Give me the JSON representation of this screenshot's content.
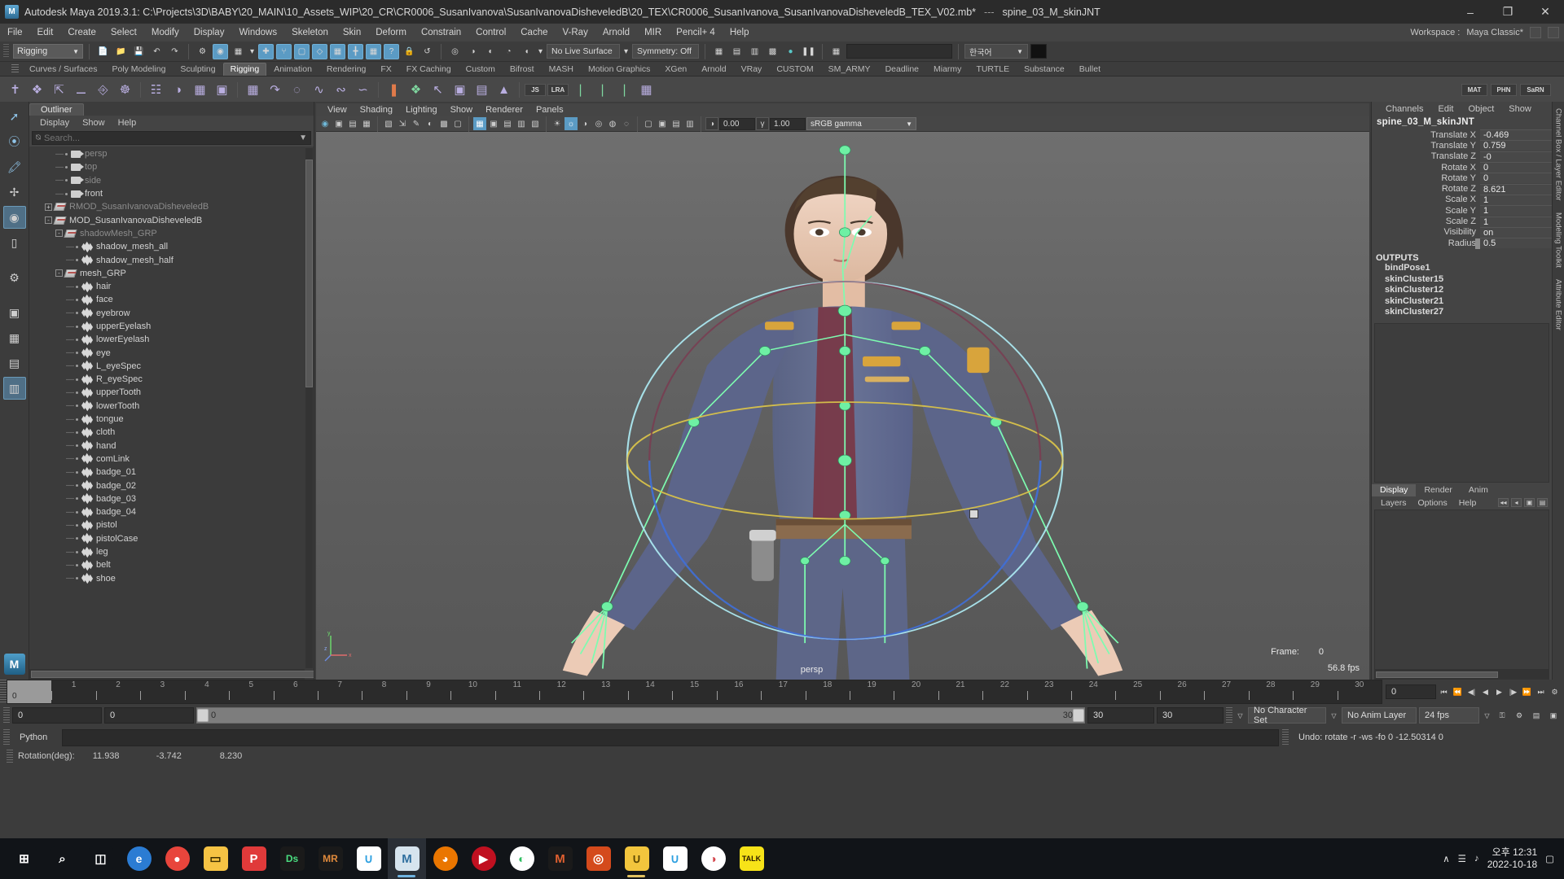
{
  "titlebar": {
    "app_title": "Autodesk Maya 2019.3.1: C:\\Projects\\3D\\BABY\\20_MAIN\\10_Assets_WIP\\20_CR\\CR0006_SusanIvanova\\SusanIvanovaDisheveledB\\20_TEX\\CR0006_SusanIvanova_SusanIvanovaDisheveledB_TEX_V02.mb*",
    "separator": "---",
    "selection": "spine_03_M_skinJNT",
    "logo": "M",
    "minimize": "–",
    "maximize": "❐",
    "close": "✕"
  },
  "menubar": {
    "items": [
      "File",
      "Edit",
      "Create",
      "Select",
      "Modify",
      "Display",
      "Windows",
      "Skeleton",
      "Skin",
      "Deform",
      "Constrain",
      "Control",
      "Cache",
      "V-Ray",
      "Arnold",
      "MIR",
      "Pencil+ 4",
      "Help"
    ],
    "workspace_label": "Workspace :",
    "workspace_value": "Maya Classic*"
  },
  "statusline": {
    "menuset": "Rigging",
    "live_surface": "No Live Surface",
    "symmetry": "Symmetry: Off",
    "quick_select": "한국어",
    "icons": [
      "new-scene-icon",
      "open-scene-icon",
      "save-scene-icon",
      "undo-icon",
      "redo-icon",
      "select-hierarchy-icon",
      "select-object-icon",
      "select-component-icon",
      "snap-grid-icon",
      "snap-curve-icon",
      "snap-point-icon",
      "snap-view-plane-icon",
      "snap-projected-center-icon",
      "construction-history-icon",
      "render-icon",
      "lock-icon",
      "input-output-icon",
      "render-view-icon",
      "ipr-icon",
      "render-settings-icon",
      "hypershade-icon",
      "light-editor-icon"
    ]
  },
  "shelf": {
    "tabs": [
      "Curves / Surfaces",
      "Poly Modeling",
      "Sculpting",
      "Rigging",
      "Animation",
      "Rendering",
      "FX",
      "FX Caching",
      "Custom",
      "Bifrost",
      "MASH",
      "Motion Graphics",
      "XGen",
      "Arnold",
      "VRay",
      "CUSTOM",
      "SM_ARMY",
      "Deadline",
      "Miarmy",
      "TURTLE",
      "Substance",
      "Bullet"
    ],
    "active_tab": "Rigging",
    "button_labels": [
      "JS",
      "LRA",
      "MAT",
      "PHN",
      "SaRN"
    ]
  },
  "outliner": {
    "tab": "Outliner",
    "menu": [
      "Display",
      "Show",
      "Help"
    ],
    "search_placeholder": "Search...",
    "items": [
      {
        "label": "persp",
        "indent": 2,
        "icon": "camera-icon",
        "dim": true,
        "expander": ""
      },
      {
        "label": "top",
        "indent": 2,
        "icon": "camera-icon",
        "dim": true,
        "expander": ""
      },
      {
        "label": "side",
        "indent": 2,
        "icon": "camera-icon",
        "dim": true,
        "expander": ""
      },
      {
        "label": "front",
        "indent": 2,
        "icon": "camera-icon",
        "dim": false,
        "expander": ""
      },
      {
        "label": "RMOD_SusanIvanovaDisheveledB",
        "indent": 1,
        "icon": "group-icon",
        "dim": true,
        "expander": "+"
      },
      {
        "label": "MOD_SusanIvanovaDisheveledB",
        "indent": 1,
        "icon": "group-icon",
        "dim": false,
        "expander": "-"
      },
      {
        "label": "shadowMesh_GRP",
        "indent": 2,
        "icon": "group-icon",
        "dim": true,
        "expander": "-"
      },
      {
        "label": "shadow_mesh_all",
        "indent": 3,
        "icon": "mesh-icon",
        "dim": false,
        "expander": ""
      },
      {
        "label": "shadow_mesh_half",
        "indent": 3,
        "icon": "mesh-icon",
        "dim": false,
        "expander": ""
      },
      {
        "label": "mesh_GRP",
        "indent": 2,
        "icon": "group-icon",
        "dim": false,
        "expander": "-"
      },
      {
        "label": "hair",
        "indent": 3,
        "icon": "mesh-icon",
        "dim": false,
        "expander": ""
      },
      {
        "label": "face",
        "indent": 3,
        "icon": "mesh-icon",
        "dim": false,
        "expander": ""
      },
      {
        "label": "eyebrow",
        "indent": 3,
        "icon": "mesh-icon",
        "dim": false,
        "expander": ""
      },
      {
        "label": "upperEyelash",
        "indent": 3,
        "icon": "mesh-icon",
        "dim": false,
        "expander": ""
      },
      {
        "label": "lowerEyelash",
        "indent": 3,
        "icon": "mesh-icon",
        "dim": false,
        "expander": ""
      },
      {
        "label": "eye",
        "indent": 3,
        "icon": "mesh-icon",
        "dim": false,
        "expander": ""
      },
      {
        "label": "L_eyeSpec",
        "indent": 3,
        "icon": "mesh-icon",
        "dim": false,
        "expander": ""
      },
      {
        "label": "R_eyeSpec",
        "indent": 3,
        "icon": "mesh-icon",
        "dim": false,
        "expander": ""
      },
      {
        "label": "upperTooth",
        "indent": 3,
        "icon": "mesh-icon",
        "dim": false,
        "expander": ""
      },
      {
        "label": "lowerTooth",
        "indent": 3,
        "icon": "mesh-icon",
        "dim": false,
        "expander": ""
      },
      {
        "label": "tongue",
        "indent": 3,
        "icon": "mesh-icon",
        "dim": false,
        "expander": ""
      },
      {
        "label": "cloth",
        "indent": 3,
        "icon": "mesh-icon",
        "dim": false,
        "expander": ""
      },
      {
        "label": "hand",
        "indent": 3,
        "icon": "mesh-icon",
        "dim": false,
        "expander": ""
      },
      {
        "label": "comLink",
        "indent": 3,
        "icon": "mesh-icon",
        "dim": false,
        "expander": ""
      },
      {
        "label": "badge_01",
        "indent": 3,
        "icon": "mesh-icon",
        "dim": false,
        "expander": ""
      },
      {
        "label": "badge_02",
        "indent": 3,
        "icon": "mesh-icon",
        "dim": false,
        "expander": ""
      },
      {
        "label": "badge_03",
        "indent": 3,
        "icon": "mesh-icon",
        "dim": false,
        "expander": ""
      },
      {
        "label": "badge_04",
        "indent": 3,
        "icon": "mesh-icon",
        "dim": false,
        "expander": ""
      },
      {
        "label": "pistol",
        "indent": 3,
        "icon": "mesh-icon",
        "dim": false,
        "expander": ""
      },
      {
        "label": "pistolCase",
        "indent": 3,
        "icon": "mesh-icon",
        "dim": false,
        "expander": ""
      },
      {
        "label": "leg",
        "indent": 3,
        "icon": "mesh-icon",
        "dim": false,
        "expander": ""
      },
      {
        "label": "belt",
        "indent": 3,
        "icon": "mesh-icon",
        "dim": false,
        "expander": ""
      },
      {
        "label": "shoe",
        "indent": 3,
        "icon": "mesh-icon",
        "dim": false,
        "expander": ""
      }
    ]
  },
  "viewport": {
    "menu": [
      "View",
      "Shading",
      "Lighting",
      "Show",
      "Renderer",
      "Panels"
    ],
    "exposure": "0.00",
    "gamma": "1.00",
    "colorspace": "sRGB gamma",
    "camera_label": "persp",
    "frame_label": "Frame:",
    "frame_value": "0",
    "fps": "56.8 fps",
    "axis_labels": {
      "x": "x",
      "y": "y",
      "z": "z"
    }
  },
  "channelbox": {
    "menu": [
      "Channels",
      "Edit",
      "Object",
      "Show"
    ],
    "node_name": "spine_03_M_skinJNT",
    "attributes": [
      {
        "label": "Translate X",
        "value": "-0.469"
      },
      {
        "label": "Translate Y",
        "value": "0.759"
      },
      {
        "label": "Translate Z",
        "value": "-0"
      },
      {
        "label": "Rotate X",
        "value": "0"
      },
      {
        "label": "Rotate Y",
        "value": "0"
      },
      {
        "label": "Rotate Z",
        "value": "8.621"
      },
      {
        "label": "Scale X",
        "value": "1"
      },
      {
        "label": "Scale Y",
        "value": "1"
      },
      {
        "label": "Scale Z",
        "value": "1"
      },
      {
        "label": "Visibility",
        "value": "on"
      },
      {
        "label": "Radius",
        "value": "0.5"
      }
    ],
    "outputs_header": "OUTPUTS",
    "outputs": [
      "bindPose1",
      "skinCluster15",
      "skinCluster12",
      "skinCluster21",
      "skinCluster27"
    ]
  },
  "layer_editor": {
    "tabs": [
      "Display",
      "Render",
      "Anim"
    ],
    "active_tab": "Display",
    "menu": [
      "Layers",
      "Options",
      "Help"
    ]
  },
  "edge_tabs": [
    "Channel Box / Layer Editor",
    "Modeling Toolkit",
    "Attribute Editor"
  ],
  "timeline": {
    "ticks": [
      "0",
      "1",
      "2",
      "3",
      "4",
      "5",
      "6",
      "7",
      "8",
      "9",
      "10",
      "11",
      "12",
      "13",
      "14",
      "15",
      "16",
      "17",
      "18",
      "19",
      "20",
      "21",
      "22",
      "23",
      "24",
      "25",
      "26",
      "27",
      "28",
      "29",
      "30"
    ],
    "current_frame": "0",
    "range_start": "0",
    "range_end": "0",
    "playback_start": "0",
    "playback_end": "30",
    "anim_start": "30",
    "anim_end": "30",
    "character_set": "No Character Set",
    "anim_layer": "No Anim Layer",
    "fps_setting": "24 fps",
    "playback_buttons": [
      "go-to-start-icon",
      "step-back-key-icon",
      "step-back-frame-icon",
      "play-backwards-icon",
      "play-forwards-icon",
      "step-forward-frame-icon",
      "step-forward-key-icon",
      "go-to-end-icon"
    ]
  },
  "commandline": {
    "language": "Python",
    "input_value": "",
    "message": "Undo: rotate -r -ws -fo 0 -12.50314 0"
  },
  "helpline": {
    "label": "Rotation(deg):",
    "values": [
      "11.938",
      "-3.742",
      "8.230"
    ]
  },
  "taskbar": {
    "items": [
      {
        "name": "start-button",
        "glyph": "⊞",
        "bg": "#111418",
        "color": "#ffffff"
      },
      {
        "name": "search-button",
        "glyph": "⌕",
        "bg": "#111418",
        "color": "#ffffff"
      },
      {
        "name": "task-view-button",
        "glyph": "◫",
        "bg": "#111418",
        "color": "#ffffff"
      },
      {
        "name": "edge-icon",
        "glyph": "e",
        "bg": "#2b7cd3",
        "color": "#ffffff",
        "shape": "circle"
      },
      {
        "name": "chrome-icon",
        "glyph": "●",
        "bg": "#e8453c",
        "color": "#ffffff",
        "shape": "circle"
      },
      {
        "name": "file-explorer-icon",
        "glyph": "▭",
        "bg": "#f6c344",
        "color": "#3a2c00",
        "shape": "square"
      },
      {
        "name": "photoshop-icon",
        "glyph": "P",
        "bg": "#e03a3a",
        "color": "#ffffff",
        "shape": "square"
      },
      {
        "name": "designer-icon",
        "glyph": "Ds",
        "bg": "#1a1a1a",
        "color": "#4ade80",
        "shape": "square"
      },
      {
        "name": "marmoset-icon",
        "glyph": "MR",
        "bg": "#1a1a1a",
        "color": "#e08a3c",
        "shape": "square"
      },
      {
        "name": "app-u-icon",
        "glyph": "∪",
        "bg": "#ffffff",
        "color": "#2b9fe0",
        "shape": "square"
      },
      {
        "name": "maya-taskbar-icon",
        "glyph": "M",
        "bg": "#d6e4ee",
        "color": "#2f6f9f",
        "shape": "square",
        "active": true
      },
      {
        "name": "blender-icon",
        "glyph": "◕",
        "bg": "#ea7600",
        "color": "#ffffff",
        "shape": "circle"
      },
      {
        "name": "media-player-icon",
        "glyph": "▶",
        "bg": "#c01020",
        "color": "#ffffff",
        "shape": "circle"
      },
      {
        "name": "evernote-icon",
        "glyph": "◐",
        "bg": "#ffffff",
        "color": "#2dbe60",
        "shape": "circle"
      },
      {
        "name": "mega-icon",
        "glyph": "M",
        "bg": "#1a1a1a",
        "color": "#e06030",
        "shape": "square"
      },
      {
        "name": "substance-icon",
        "glyph": "◎",
        "bg": "#d44a1c",
        "color": "#ffffff",
        "shape": "square"
      },
      {
        "name": "zbrush-icon",
        "glyph": "∪",
        "bg": "#f2c53d",
        "color": "#5a4500",
        "shape": "square",
        "running": true
      },
      {
        "name": "app-u2-icon",
        "glyph": "∪",
        "bg": "#ffffff",
        "color": "#2b9fe0",
        "shape": "square"
      },
      {
        "name": "opera-icon",
        "glyph": "◑",
        "bg": "#ffffff",
        "color": "#d4454c",
        "shape": "circle"
      },
      {
        "name": "kakaotalk-icon",
        "glyph": "TALK",
        "bg": "#f7e318",
        "color": "#2a1a00",
        "shape": "square"
      }
    ],
    "tray": {
      "arrow": "∧",
      "network": "☰",
      "speaker": "♪",
      "time": "오후 12:31",
      "date": "2022-10-18",
      "notification": "▢"
    }
  }
}
